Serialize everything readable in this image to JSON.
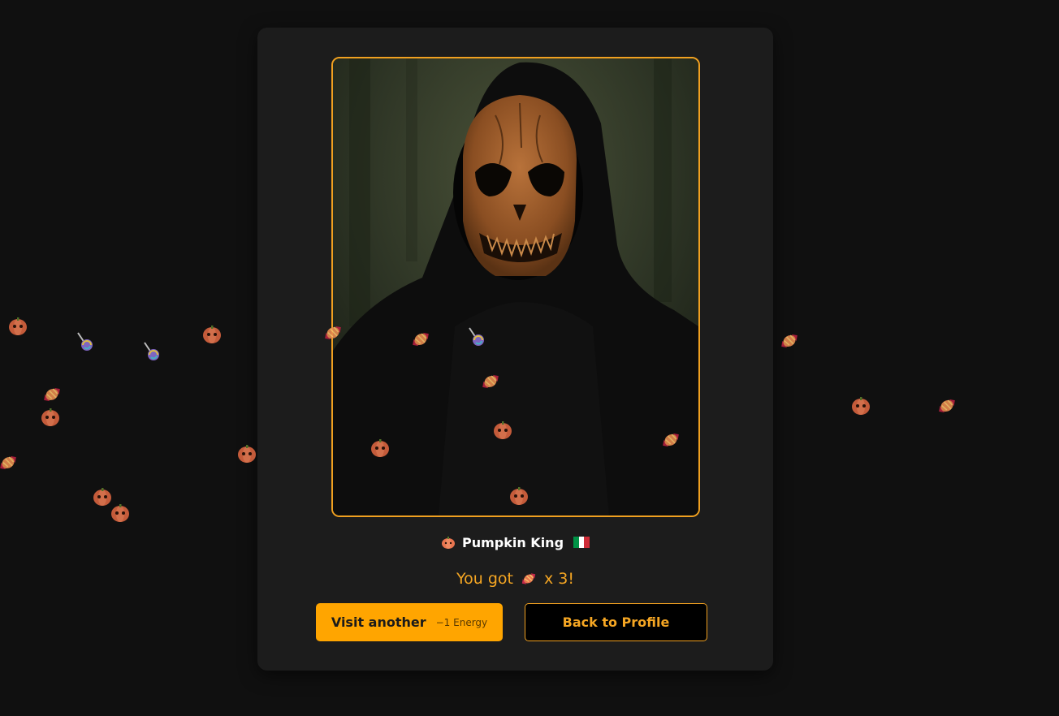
{
  "profile": {
    "name": "Pumpkin King",
    "badge_icon": "pumpkin-icon",
    "flag_icon": "italy-flag-icon",
    "flag_colors": [
      "#009246",
      "#ffffff",
      "#ce2b37"
    ]
  },
  "photo": {
    "subject": "hooded figure with carved pumpkin skull mask",
    "icon": "costume-photo"
  },
  "result": {
    "prefix": "You got",
    "reward_icon": "candy-icon",
    "suffix": "x 3!"
  },
  "buttons": {
    "visit_label": "Visit another",
    "visit_cost": "−1 Energy",
    "back_label": "Back to Profile"
  },
  "colors": {
    "accent": "#ffa500",
    "background": "#101010",
    "card": "#1c1c1c"
  },
  "floating_treats": [
    {
      "icon": "pumpkin-icon"
    },
    {
      "icon": "lollipop-icon"
    },
    {
      "icon": "lollipop-icon"
    },
    {
      "icon": "pumpkin-icon"
    },
    {
      "icon": "candy-icon"
    },
    {
      "icon": "candy-icon"
    },
    {
      "icon": "lollipop-icon"
    },
    {
      "icon": "candy-icon"
    },
    {
      "icon": "candy-icon"
    },
    {
      "icon": "pumpkin-icon"
    },
    {
      "icon": "pumpkin-icon"
    },
    {
      "icon": "pumpkin-icon"
    },
    {
      "icon": "candy-icon"
    },
    {
      "icon": "pumpkin-icon"
    },
    {
      "icon": "candy-icon"
    },
    {
      "icon": "candy-icon"
    },
    {
      "icon": "pumpkin-icon"
    },
    {
      "icon": "pumpkin-icon"
    },
    {
      "icon": "pumpkin-icon"
    },
    {
      "icon": "pumpkin-icon"
    },
    {
      "icon": "candy-icon"
    },
    {
      "icon": "candy-icon"
    },
    {
      "icon": "lollipop-icon"
    }
  ]
}
